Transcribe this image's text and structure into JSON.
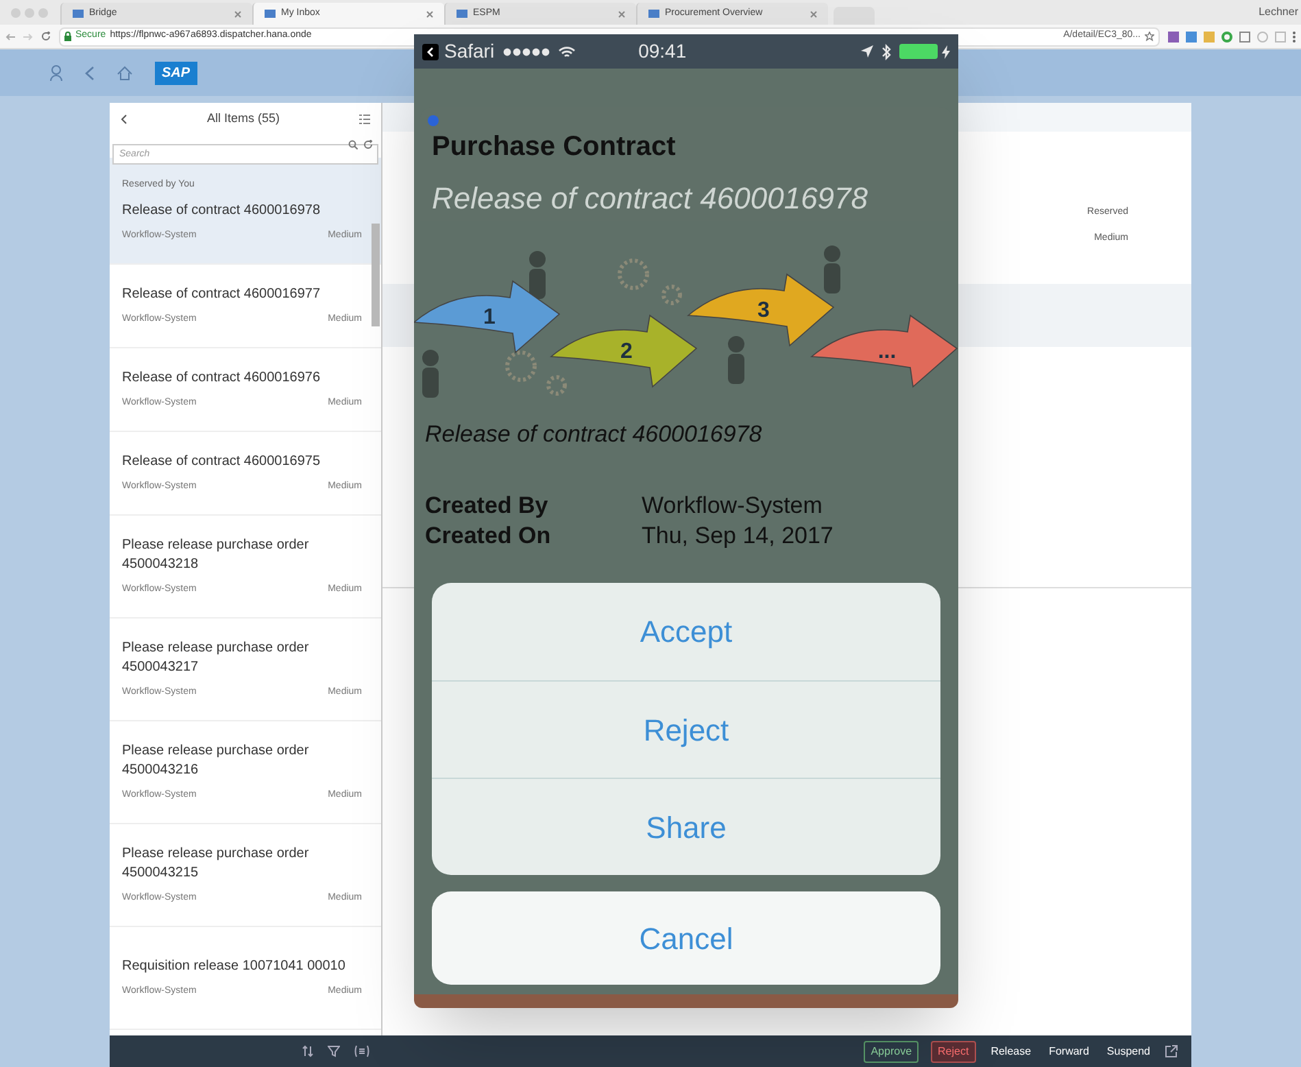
{
  "browser": {
    "tabs": [
      {
        "label": "Bridge",
        "selected": false
      },
      {
        "label": "My Inbox",
        "selected": true
      },
      {
        "label": "ESPM",
        "selected": false
      },
      {
        "label": "Procurement Overview",
        "selected": false
      }
    ],
    "user": "Lechner",
    "secure_label": "Secure",
    "url_start": "https://flpnwc-a967a6893.dispatcher.hana.onde",
    "url_end": "A/detail/EC3_80..."
  },
  "shell": {
    "logo": "SAP"
  },
  "master": {
    "title": "All Items (55)",
    "search": {
      "placeholder": "Search"
    },
    "items": [
      {
        "note": "Reserved by You",
        "title": "Release of contract 4600016978",
        "created_by": "Workflow-System",
        "priority": "Medium",
        "selected": true
      },
      {
        "title": "Release of contract 4600016977",
        "created_by": "Workflow-System",
        "priority": "Medium",
        "selected": false
      },
      {
        "title": "Release of contract 4600016976",
        "created_by": "Workflow-System",
        "priority": "Medium",
        "selected": false
      },
      {
        "title": "Release of contract 4600016975",
        "created_by": "Workflow-System",
        "priority": "Medium",
        "selected": false
      },
      {
        "title": "Please release purchase order 4500043218",
        "created_by": "Workflow-System",
        "priority": "Medium",
        "selected": false
      },
      {
        "title": "Please release purchase order 4500043217",
        "created_by": "Workflow-System",
        "priority": "Medium",
        "selected": false
      },
      {
        "title": "Please release purchase order 4500043216",
        "created_by": "Workflow-System",
        "priority": "Medium",
        "selected": false
      },
      {
        "title": "Please release purchase order 4500043215",
        "created_by": "Workflow-System",
        "priority": "Medium",
        "selected": false
      },
      {
        "title": "Requisition release 10071041 00010",
        "created_by": "Workflow-System",
        "priority": "Medium",
        "selected": false
      }
    ]
  },
  "detail": {
    "status": "Reserved",
    "priority": "Medium"
  },
  "footer": {
    "actions": [
      {
        "label": "Approve",
        "kind": "accept"
      },
      {
        "label": "Reject",
        "kind": "reject"
      },
      {
        "label": "Release",
        "kind": "plain"
      },
      {
        "label": "Forward",
        "kind": "plain"
      },
      {
        "label": "Suspend",
        "kind": "plain"
      }
    ]
  },
  "phone": {
    "status_bar": {
      "app": "Safari",
      "time": "09:41"
    },
    "title": "Purchase Contract",
    "subtitle": "Release of contract 4600016978",
    "steps": [
      "1",
      "2",
      "3",
      "..."
    ],
    "caption": "Release of contract 4600016978",
    "fields": [
      {
        "label": "Created By",
        "value": "Workflow-System"
      },
      {
        "label": "Created On",
        "value": "Thu, Sep 14, 2017"
      }
    ],
    "action_sheet": {
      "actions": [
        "Accept",
        "Reject",
        "Share"
      ],
      "cancel": "Cancel"
    }
  }
}
